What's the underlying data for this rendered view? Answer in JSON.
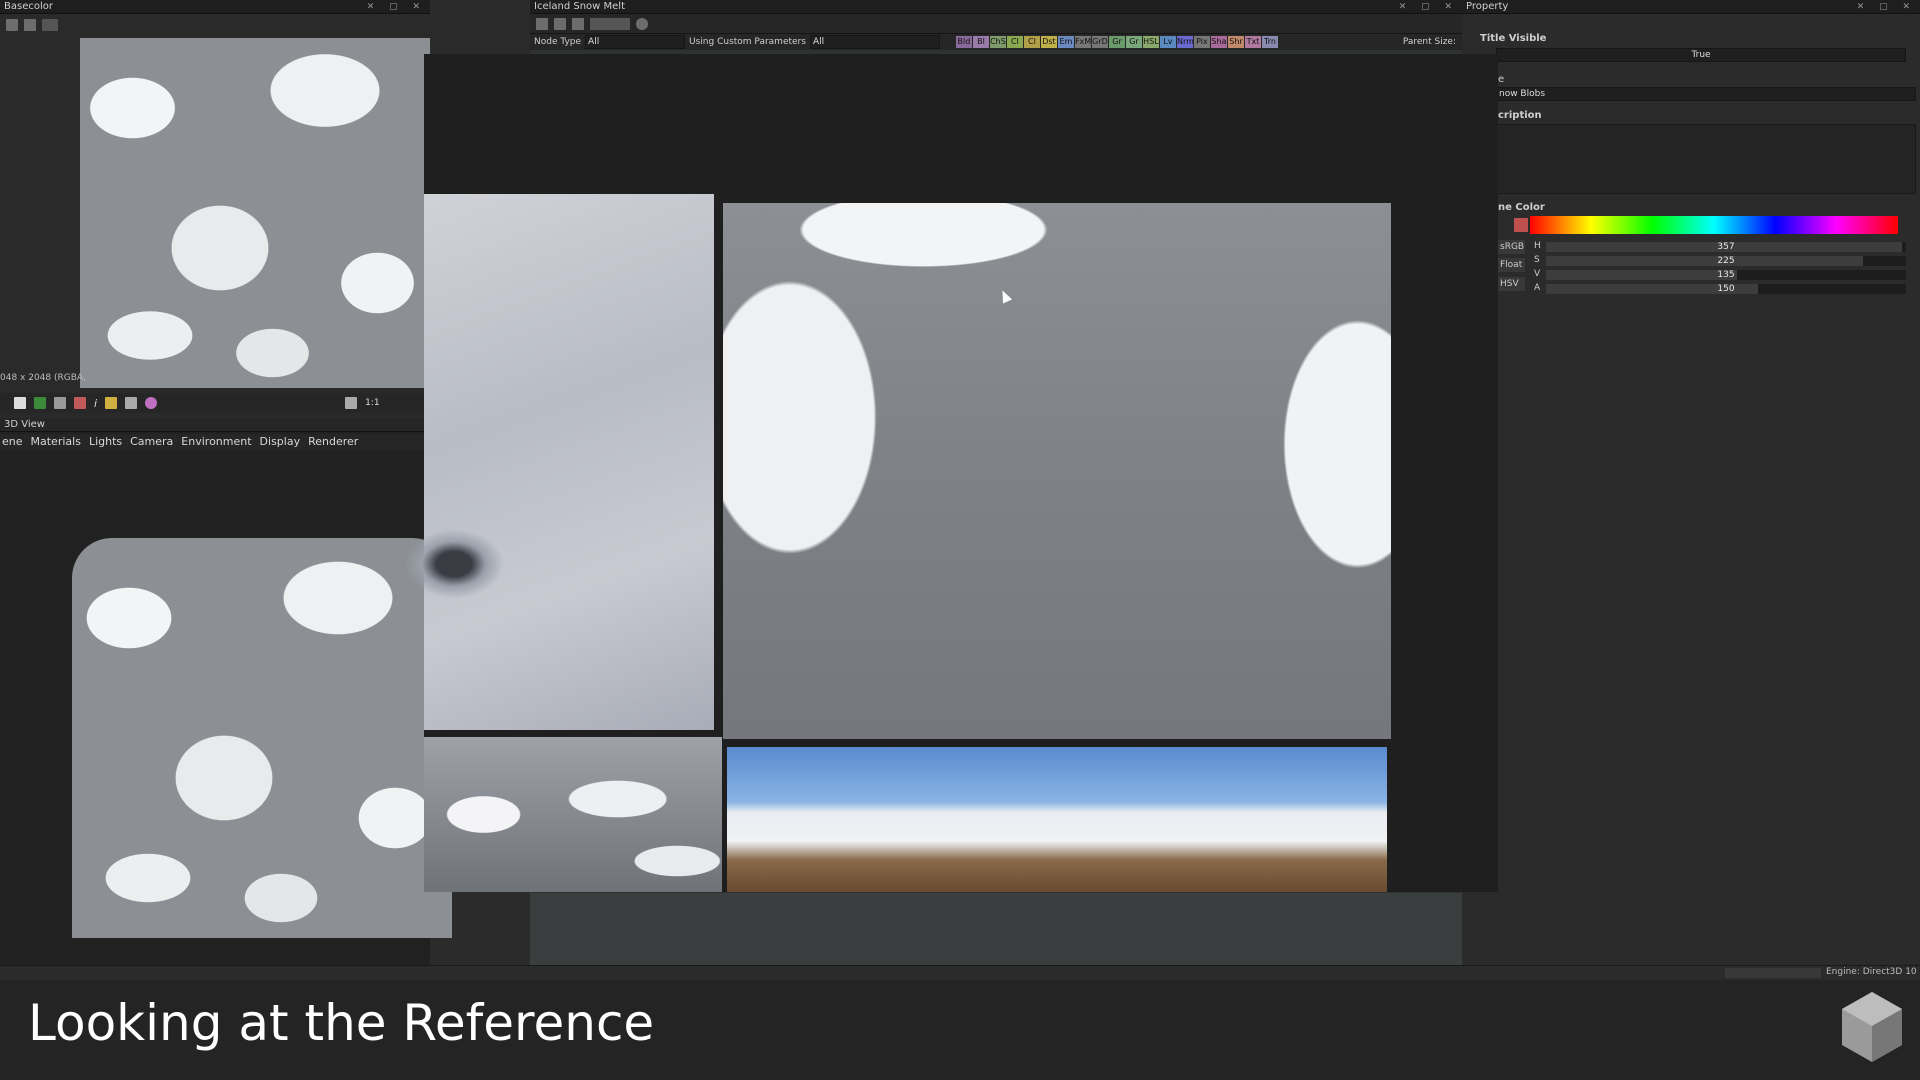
{
  "basecolor_panel": {
    "title": "Basecolor",
    "resolution": "048 x 2048 (RGBA,",
    "zoom": "1:1"
  },
  "view3d_panel": {
    "title": "3D View",
    "menu": [
      "ene",
      "Materials",
      "Lights",
      "Camera",
      "Environment",
      "Display",
      "Renderer"
    ]
  },
  "graph_panel": {
    "title": "Iceland Snow Melt",
    "node_type_label": "Node Type",
    "node_type_value": "All",
    "custom_params_label": "Using Custom Parameters",
    "custom_params_value": "All",
    "parent_size_label": "Parent Size:",
    "filters": [
      {
        "label": "Bld",
        "color": "#8a6a9a"
      },
      {
        "label": "Bl",
        "color": "#9a7aa8"
      },
      {
        "label": "ChS",
        "color": "#7e9a6a"
      },
      {
        "label": "Cl",
        "color": "#8aa850"
      },
      {
        "label": "Cl",
        "color": "#b0a048"
      },
      {
        "label": "Dst",
        "color": "#c0b04a"
      },
      {
        "label": "Em",
        "color": "#6a8ac0"
      },
      {
        "label": "FxM",
        "color": "#777777"
      },
      {
        "label": "GrD",
        "color": "#777777"
      },
      {
        "label": "Gr",
        "color": "#6a9a6a"
      },
      {
        "label": "Gr",
        "color": "#7aa87a"
      },
      {
        "label": "HSL",
        "color": "#8aa86a"
      },
      {
        "label": "Lv",
        "color": "#5a8ac0"
      },
      {
        "label": "Nrm",
        "color": "#6a6ad0"
      },
      {
        "label": "Pix",
        "color": "#777777"
      },
      {
        "label": "Sha",
        "color": "#a86a9a"
      },
      {
        "label": "Shr",
        "color": "#c08a6a"
      },
      {
        "label": "Txt",
        "color": "#b07aa0"
      },
      {
        "label": "Trn",
        "color": "#8a8ab0"
      }
    ]
  },
  "property_panel": {
    "title": "Property",
    "title_visible_label": "Title Visible",
    "title_visible_value": "True",
    "label_section": "e",
    "label_value": "now Blobs",
    "description_label": "cription",
    "frame_color_label": "ne Color",
    "modes": [
      "sRGB",
      "Float",
      "HSV"
    ],
    "sliders": [
      {
        "label": "H",
        "value": "357",
        "fraction": 0.99
      },
      {
        "label": "S",
        "value": "225",
        "fraction": 0.88
      },
      {
        "label": "V",
        "value": "135",
        "fraction": 0.53
      },
      {
        "label": "A",
        "value": "150",
        "fraction": 0.59
      }
    ]
  },
  "status_bar": {
    "engine": "Engine: Direct3D 10"
  },
  "caption": {
    "text": "Looking at the Reference"
  },
  "colors": {
    "accent_swatch": "#c0504d",
    "panel_bg": "#2b2b2b"
  }
}
